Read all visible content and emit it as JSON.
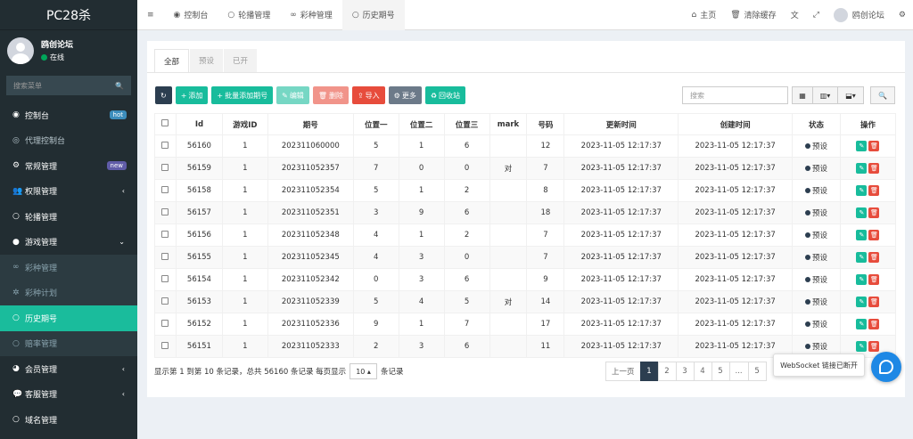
{
  "app": {
    "title": "PC28杀"
  },
  "user": {
    "name": "鸥创论坛",
    "status": "在线"
  },
  "search": {
    "placeholder": "搜索菜单"
  },
  "sidebar": {
    "items": [
      {
        "label": "控制台",
        "icon": "dashboard-icon",
        "badge": "hot",
        "badge_color": "#3c8dbc"
      },
      {
        "label": "代理控制台",
        "icon": "globe-icon"
      },
      {
        "label": "常规管理",
        "icon": "gears-icon",
        "badge": "new",
        "badge_color": "#605ca8"
      },
      {
        "label": "权限管理",
        "icon": "users-icon",
        "arrow": "‹"
      },
      {
        "label": "轮播管理",
        "icon": "circle-icon"
      },
      {
        "label": "游戏管理",
        "icon": "bomb-icon",
        "arrow": "⌄"
      },
      {
        "label": "彩种管理",
        "icon": "gamepad-icon"
      },
      {
        "label": "彩种计划",
        "icon": "empire-icon"
      },
      {
        "label": "历史期号",
        "icon": "circle-icon"
      },
      {
        "label": "赔率管理",
        "icon": "circle-icon"
      },
      {
        "label": "会员管理",
        "icon": "user-circle-icon",
        "arrow": "‹"
      },
      {
        "label": "客服管理",
        "icon": "comments-icon",
        "arrow": "‹"
      },
      {
        "label": "域名管理",
        "icon": "circle-icon"
      }
    ]
  },
  "topnav": {
    "tabs": [
      {
        "label": "控制台",
        "icon": "dashboard-icon"
      },
      {
        "label": "轮播管理",
        "icon": "circle-icon"
      },
      {
        "label": "彩种管理",
        "icon": "gamepad-icon"
      },
      {
        "label": "历史期号",
        "icon": "circle-icon"
      }
    ],
    "home": "主页",
    "clear_cache": "清除缓存",
    "username": "鸥创论坛"
  },
  "content_tabs": [
    "全部",
    "预设",
    "已开"
  ],
  "toolbar": {
    "add": "添加",
    "batch_add": "批量添加期号",
    "edit": "编辑",
    "delete": "删除",
    "import": "导入",
    "more": "更多",
    "recycle": "回收站",
    "search_placeholder": "搜索"
  },
  "colors": {
    "accent": "#18bc9c",
    "danger": "#e74c3c",
    "dark": "#2c3e50",
    "sidebar": "#222d32"
  },
  "table": {
    "headers": [
      "Id",
      "游戏ID",
      "期号",
      "位置一",
      "位置二",
      "位置三",
      "mark",
      "号码",
      "更新时间",
      "创建时间",
      "状态",
      "操作"
    ],
    "rows": [
      [
        "56160",
        "1",
        "202311060000",
        "5",
        "1",
        "6",
        "",
        "12",
        "2023-11-05 12:17:37",
        "2023-11-05 12:17:37",
        "预设"
      ],
      [
        "56159",
        "1",
        "202311052357",
        "7",
        "0",
        "0",
        "对",
        "7",
        "2023-11-05 12:17:37",
        "2023-11-05 12:17:37",
        "预设"
      ],
      [
        "56158",
        "1",
        "202311052354",
        "5",
        "1",
        "2",
        "",
        "8",
        "2023-11-05 12:17:37",
        "2023-11-05 12:17:37",
        "预设"
      ],
      [
        "56157",
        "1",
        "202311052351",
        "3",
        "9",
        "6",
        "",
        "18",
        "2023-11-05 12:17:37",
        "2023-11-05 12:17:37",
        "预设"
      ],
      [
        "56156",
        "1",
        "202311052348",
        "4",
        "1",
        "2",
        "",
        "7",
        "2023-11-05 12:17:37",
        "2023-11-05 12:17:37",
        "预设"
      ],
      [
        "56155",
        "1",
        "202311052345",
        "4",
        "3",
        "0",
        "",
        "7",
        "2023-11-05 12:17:37",
        "2023-11-05 12:17:37",
        "预设"
      ],
      [
        "56154",
        "1",
        "202311052342",
        "0",
        "3",
        "6",
        "",
        "9",
        "2023-11-05 12:17:37",
        "2023-11-05 12:17:37",
        "预设"
      ],
      [
        "56153",
        "1",
        "202311052339",
        "5",
        "4",
        "5",
        "对",
        "14",
        "2023-11-05 12:17:37",
        "2023-11-05 12:17:37",
        "预设"
      ],
      [
        "56152",
        "1",
        "202311052336",
        "9",
        "1",
        "7",
        "",
        "17",
        "2023-11-05 12:17:37",
        "2023-11-05 12:17:37",
        "预设"
      ],
      [
        "56151",
        "1",
        "202311052333",
        "2",
        "3",
        "6",
        "",
        "11",
        "2023-11-05 12:17:37",
        "2023-11-05 12:17:37",
        "预设"
      ]
    ]
  },
  "footer": {
    "summary": "显示第 1 到第 10 条记录，总共 56160 条记录 每页显示",
    "page_size": "10",
    "suffix": "条记录"
  },
  "pager": [
    "上一页",
    "1",
    "2",
    "3",
    "4",
    "5",
    "...",
    "5"
  ],
  "ws_message": "WebSocket 链接已断开"
}
